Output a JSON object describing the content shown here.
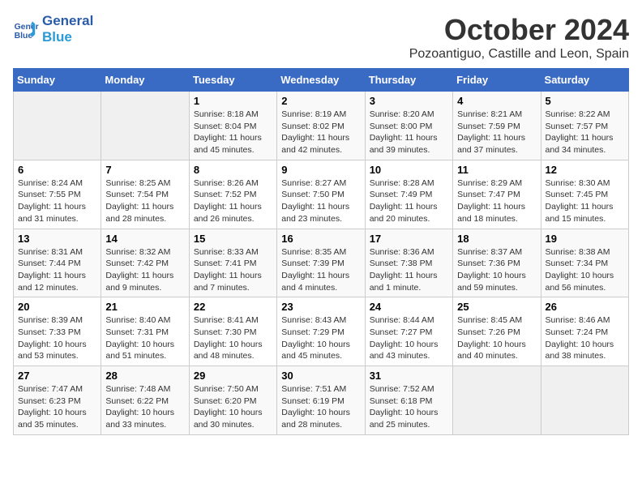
{
  "logo": {
    "line1": "General",
    "line2": "Blue"
  },
  "title": "October 2024",
  "location": "Pozoantiguo, Castille and Leon, Spain",
  "headers": [
    "Sunday",
    "Monday",
    "Tuesday",
    "Wednesday",
    "Thursday",
    "Friday",
    "Saturday"
  ],
  "weeks": [
    [
      {
        "day": "",
        "info": ""
      },
      {
        "day": "",
        "info": ""
      },
      {
        "day": "1",
        "info": "Sunrise: 8:18 AM\nSunset: 8:04 PM\nDaylight: 11 hours and 45 minutes."
      },
      {
        "day": "2",
        "info": "Sunrise: 8:19 AM\nSunset: 8:02 PM\nDaylight: 11 hours and 42 minutes."
      },
      {
        "day": "3",
        "info": "Sunrise: 8:20 AM\nSunset: 8:00 PM\nDaylight: 11 hours and 39 minutes."
      },
      {
        "day": "4",
        "info": "Sunrise: 8:21 AM\nSunset: 7:59 PM\nDaylight: 11 hours and 37 minutes."
      },
      {
        "day": "5",
        "info": "Sunrise: 8:22 AM\nSunset: 7:57 PM\nDaylight: 11 hours and 34 minutes."
      }
    ],
    [
      {
        "day": "6",
        "info": "Sunrise: 8:24 AM\nSunset: 7:55 PM\nDaylight: 11 hours and 31 minutes."
      },
      {
        "day": "7",
        "info": "Sunrise: 8:25 AM\nSunset: 7:54 PM\nDaylight: 11 hours and 28 minutes."
      },
      {
        "day": "8",
        "info": "Sunrise: 8:26 AM\nSunset: 7:52 PM\nDaylight: 11 hours and 26 minutes."
      },
      {
        "day": "9",
        "info": "Sunrise: 8:27 AM\nSunset: 7:50 PM\nDaylight: 11 hours and 23 minutes."
      },
      {
        "day": "10",
        "info": "Sunrise: 8:28 AM\nSunset: 7:49 PM\nDaylight: 11 hours and 20 minutes."
      },
      {
        "day": "11",
        "info": "Sunrise: 8:29 AM\nSunset: 7:47 PM\nDaylight: 11 hours and 18 minutes."
      },
      {
        "day": "12",
        "info": "Sunrise: 8:30 AM\nSunset: 7:45 PM\nDaylight: 11 hours and 15 minutes."
      }
    ],
    [
      {
        "day": "13",
        "info": "Sunrise: 8:31 AM\nSunset: 7:44 PM\nDaylight: 11 hours and 12 minutes."
      },
      {
        "day": "14",
        "info": "Sunrise: 8:32 AM\nSunset: 7:42 PM\nDaylight: 11 hours and 9 minutes."
      },
      {
        "day": "15",
        "info": "Sunrise: 8:33 AM\nSunset: 7:41 PM\nDaylight: 11 hours and 7 minutes."
      },
      {
        "day": "16",
        "info": "Sunrise: 8:35 AM\nSunset: 7:39 PM\nDaylight: 11 hours and 4 minutes."
      },
      {
        "day": "17",
        "info": "Sunrise: 8:36 AM\nSunset: 7:38 PM\nDaylight: 11 hours and 1 minute."
      },
      {
        "day": "18",
        "info": "Sunrise: 8:37 AM\nSunset: 7:36 PM\nDaylight: 10 hours and 59 minutes."
      },
      {
        "day": "19",
        "info": "Sunrise: 8:38 AM\nSunset: 7:34 PM\nDaylight: 10 hours and 56 minutes."
      }
    ],
    [
      {
        "day": "20",
        "info": "Sunrise: 8:39 AM\nSunset: 7:33 PM\nDaylight: 10 hours and 53 minutes."
      },
      {
        "day": "21",
        "info": "Sunrise: 8:40 AM\nSunset: 7:31 PM\nDaylight: 10 hours and 51 minutes."
      },
      {
        "day": "22",
        "info": "Sunrise: 8:41 AM\nSunset: 7:30 PM\nDaylight: 10 hours and 48 minutes."
      },
      {
        "day": "23",
        "info": "Sunrise: 8:43 AM\nSunset: 7:29 PM\nDaylight: 10 hours and 45 minutes."
      },
      {
        "day": "24",
        "info": "Sunrise: 8:44 AM\nSunset: 7:27 PM\nDaylight: 10 hours and 43 minutes."
      },
      {
        "day": "25",
        "info": "Sunrise: 8:45 AM\nSunset: 7:26 PM\nDaylight: 10 hours and 40 minutes."
      },
      {
        "day": "26",
        "info": "Sunrise: 8:46 AM\nSunset: 7:24 PM\nDaylight: 10 hours and 38 minutes."
      }
    ],
    [
      {
        "day": "27",
        "info": "Sunrise: 7:47 AM\nSunset: 6:23 PM\nDaylight: 10 hours and 35 minutes."
      },
      {
        "day": "28",
        "info": "Sunrise: 7:48 AM\nSunset: 6:22 PM\nDaylight: 10 hours and 33 minutes."
      },
      {
        "day": "29",
        "info": "Sunrise: 7:50 AM\nSunset: 6:20 PM\nDaylight: 10 hours and 30 minutes."
      },
      {
        "day": "30",
        "info": "Sunrise: 7:51 AM\nSunset: 6:19 PM\nDaylight: 10 hours and 28 minutes."
      },
      {
        "day": "31",
        "info": "Sunrise: 7:52 AM\nSunset: 6:18 PM\nDaylight: 10 hours and 25 minutes."
      },
      {
        "day": "",
        "info": ""
      },
      {
        "day": "",
        "info": ""
      }
    ]
  ]
}
